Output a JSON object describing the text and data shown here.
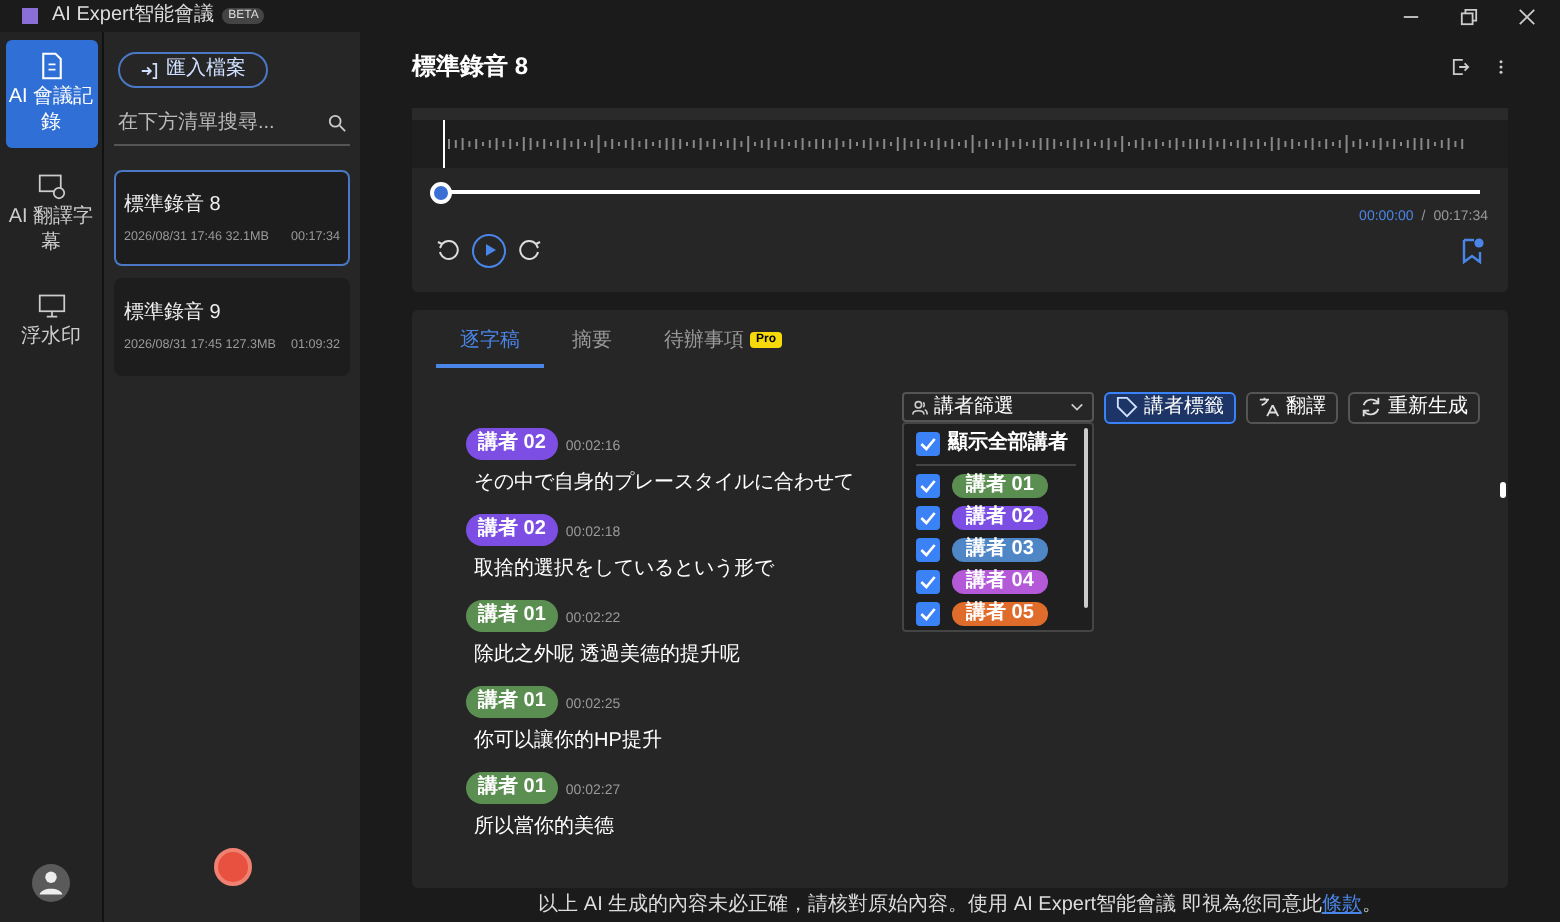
{
  "app_title": "AI Expert智能會議",
  "app_badge": "BETA",
  "nav": [
    {
      "label": "AI 會議記錄",
      "kind": "doc",
      "selected": true
    },
    {
      "label": "AI 翻譯字幕",
      "kind": "subtitle",
      "selected": false
    },
    {
      "label": "浮水印",
      "kind": "monitor",
      "selected": false
    }
  ],
  "import_button": "匯入檔案",
  "search": {
    "placeholder": "在下方清單搜尋..."
  },
  "recordings": [
    {
      "title": "標準錄音 8",
      "meta": "2026/08/31 17:46 32.1MB",
      "duration": "00:17:34",
      "selected": true
    },
    {
      "title": "標準錄音 9",
      "meta": "2026/08/31 17:45 127.3MB",
      "duration": "01:09:32",
      "selected": false
    }
  ],
  "header": {
    "title": "標準錄音 8"
  },
  "player": {
    "level": 0,
    "current": "00:00:00",
    "separator": "/",
    "total": "00:17:34"
  },
  "tabs": [
    {
      "label": "逐字稿",
      "selected": true
    },
    {
      "label": "摘要",
      "selected": false
    },
    {
      "label": "待辦事項",
      "badge": "Pro",
      "selected": false
    }
  ],
  "speaker_filter": {
    "label": "講者篩選",
    "show_all": {
      "label": "顯示全部講者",
      "checked": true
    },
    "options": [
      {
        "speaker": "講者 01",
        "color": "#5b8f52",
        "checked": true
      },
      {
        "speaker": "講者 02",
        "color": "#7c4ee4",
        "checked": true
      },
      {
        "speaker": "講者 03",
        "color": "#4f86c6",
        "checked": true
      },
      {
        "speaker": "講者 04",
        "color": "#b45ad8",
        "checked": true
      },
      {
        "speaker": "講者 05",
        "color": "#e06c2c",
        "checked": true
      }
    ]
  },
  "toolbar_buttons": [
    {
      "label": "講者標籤",
      "kind": "tag",
      "active": true
    },
    {
      "label": "翻譯",
      "kind": "translate",
      "active": false
    },
    {
      "label": "重新生成",
      "kind": "refresh",
      "active": false
    }
  ],
  "transcript": [
    {
      "speaker": "講者 02",
      "color": "#7c4ee4",
      "time": "00:02:16",
      "text": "その中で自身的プレースタイルに合わせて"
    },
    {
      "speaker": "講者 02",
      "color": "#7c4ee4",
      "time": "00:02:18",
      "text": "取捨的選択をしているという形で"
    },
    {
      "speaker": "講者 01",
      "color": "#5b8f52",
      "time": "00:02:22",
      "text": "除此之外呢 透過美德的提升呢"
    },
    {
      "speaker": "講者 01",
      "color": "#5b8f52",
      "time": "00:02:25",
      "text": "你可以讓你的HP提升"
    },
    {
      "speaker": "講者 01",
      "color": "#5b8f52",
      "time": "00:02:27",
      "text": "所以當你的美德"
    }
  ],
  "footer": {
    "text": "以上 AI 生成的內容未必正確，請核對原始內容。使用 AI Expert智能會議 即視為您同意此",
    "link": "條款",
    "end": "。"
  }
}
